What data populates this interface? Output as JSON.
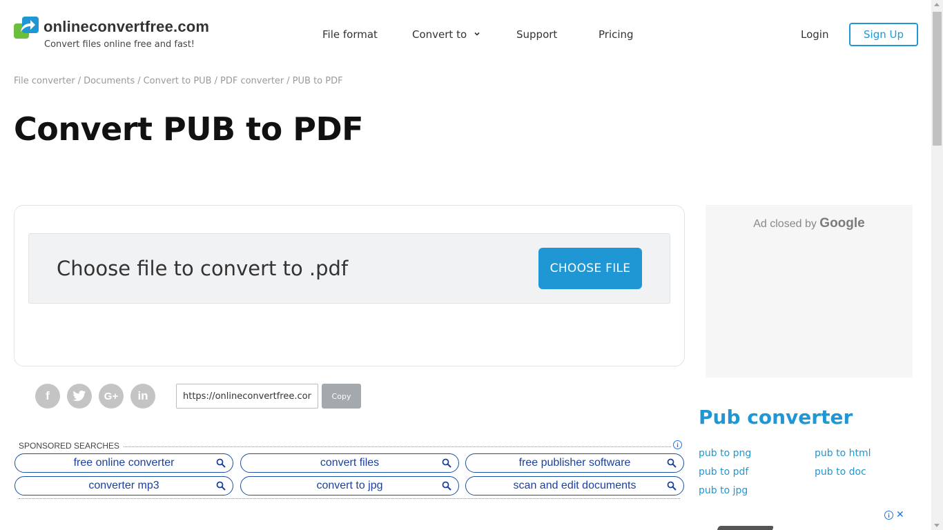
{
  "header": {
    "logo_name": "onlineconvertfree.com",
    "logo_tagline": "Convert files online free and fast!",
    "nav": {
      "file_format": "File format",
      "convert_to": "Convert to",
      "support": "Support",
      "pricing": "Pricing"
    },
    "login": "Login",
    "signup": "Sign Up"
  },
  "breadcrumb": [
    "File converter",
    "Documents",
    "Convert to PUB",
    "PDF converter",
    "PUB to PDF"
  ],
  "page_title": "Convert PUB to PDF",
  "converter": {
    "prompt": "Choose file to convert to .pdf",
    "choose_button": "CHOOSE FILE"
  },
  "share": {
    "url": "https://onlineconvertfree.com/convert/pub-to-pdf/",
    "copy": "Copy",
    "icons": [
      "facebook-icon",
      "twitter-icon",
      "google-plus-icon",
      "linkedin-icon"
    ]
  },
  "sponsored": {
    "label": "SPONSORED SEARCHES",
    "items": [
      "free online converter",
      "convert files",
      "free publisher software",
      "converter mp3",
      "convert to jpg",
      "scan and edit documents"
    ]
  },
  "ad": {
    "text": "Ad closed by",
    "brand": "Google"
  },
  "sidebar": {
    "title": "Pub converter",
    "links": [
      "pub to png",
      "pub to html",
      "pub to pdf",
      "pub to doc",
      "pub to jpg"
    ]
  },
  "colors": {
    "accent": "#1e97d4",
    "sponsored_blue": "#1a3fa0",
    "social_gray": "#c4c4c4"
  }
}
